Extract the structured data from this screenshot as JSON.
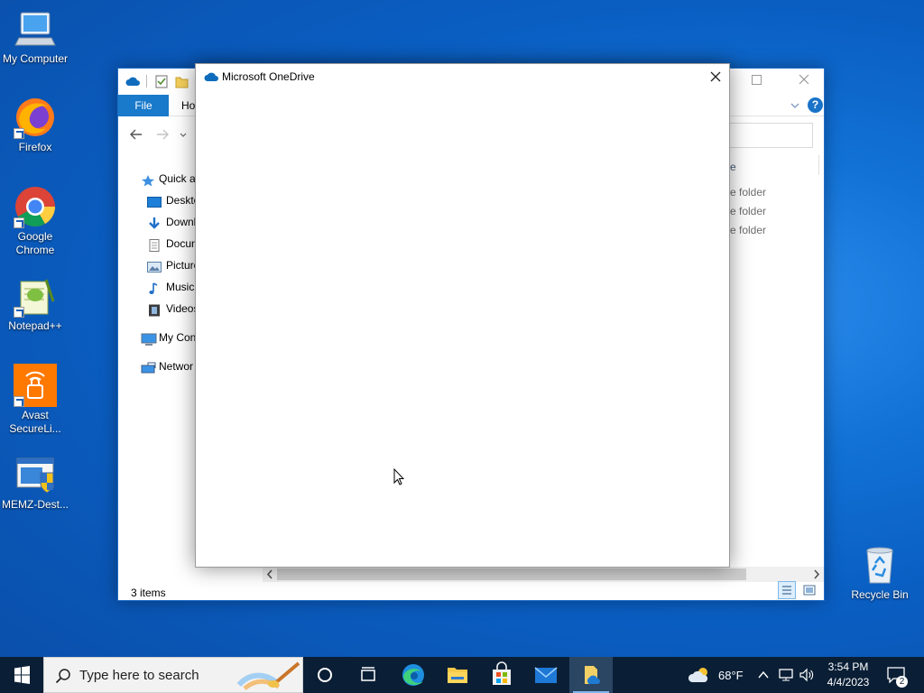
{
  "desktop": {
    "icons": [
      {
        "label": "My Computer"
      },
      {
        "label": "Firefox"
      },
      {
        "label": "Google Chrome"
      },
      {
        "label": "Notepad++"
      },
      {
        "label": "Avast SecureLi..."
      },
      {
        "label": "MEMZ-Dest..."
      },
      {
        "label": "Recycle Bin"
      }
    ]
  },
  "explorer": {
    "ribbon": {
      "file_tab": "File",
      "home_tab": "Ho"
    },
    "nav_pane": [
      {
        "label": "Quick a",
        "icon": "star-icon"
      },
      {
        "label": "Deskto",
        "icon": "desktop-icon"
      },
      {
        "label": "Downl",
        "icon": "download-icon"
      },
      {
        "label": "Docun",
        "icon": "document-icon"
      },
      {
        "label": "Picture",
        "icon": "pictures-icon"
      },
      {
        "label": "Music",
        "icon": "music-icon"
      },
      {
        "label": "Videos",
        "icon": "videos-icon"
      },
      {
        "label": "My Con",
        "icon": "computer-icon"
      },
      {
        "label": "Networ",
        "icon": "network-icon"
      }
    ],
    "column_header": "e",
    "rows": [
      "e folder",
      "e folder",
      "e folder"
    ],
    "status": "3 items"
  },
  "onedrive_dialog": {
    "title": "Microsoft OneDrive"
  },
  "taskbar": {
    "search_placeholder": "Type here to search",
    "weather": {
      "temp": "68°F"
    },
    "clock": {
      "time": "3:54 PM",
      "date": "4/4/2023"
    },
    "notification_count": "2"
  },
  "colors": {
    "accent": "#1979ca",
    "desktop": "#0a5ec2",
    "taskbar": "#0a1f36"
  }
}
